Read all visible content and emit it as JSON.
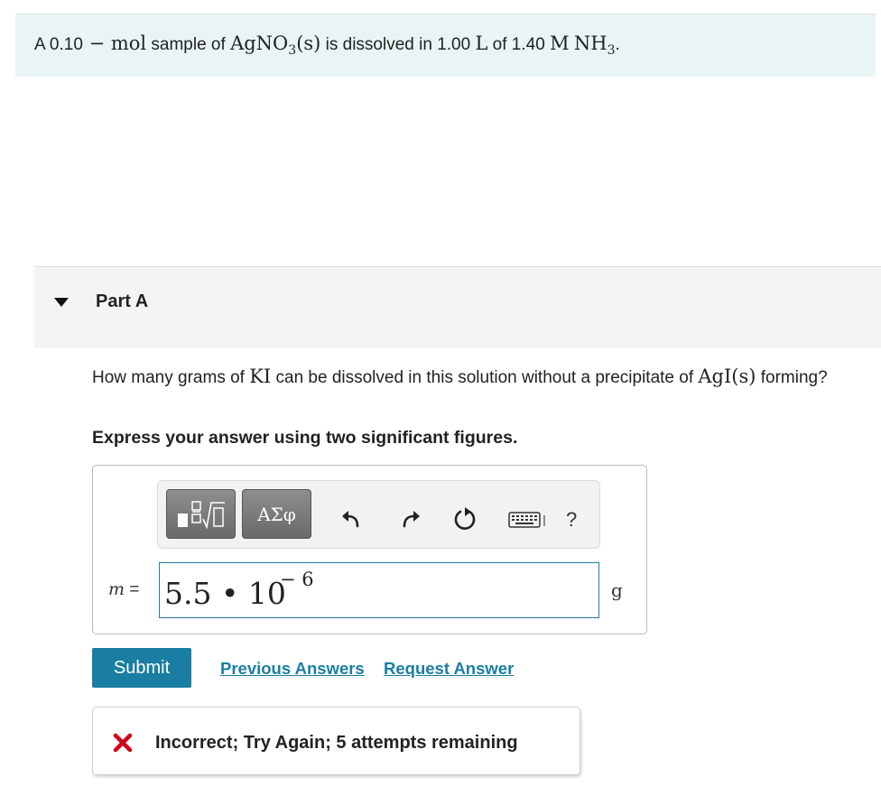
{
  "intro": {
    "prefix": "A 0.10",
    "dash": " − ",
    "mol": "mol",
    "sample_of": " sample of ",
    "compound_main": "AgNO",
    "compound_sub": "3",
    "compound_state": "(s)",
    "dissolved_in": " is dissolved in 1.00 ",
    "liter": "L",
    "of": " of 1.40 ",
    "molar": "M",
    "nh": "NH",
    "nh_sub": "3",
    "period": "."
  },
  "part": {
    "title": "Part A"
  },
  "question": {
    "before": "How many grams of ",
    "ki": "KI",
    "middle": " can be dissolved in this solution without a precipitate of ",
    "agi": "AgI(s)",
    "after": " forming?"
  },
  "instruction": "Express your answer using two significant figures.",
  "toolbar": {
    "templates_icon": "templates-icon",
    "symbols_label": "ΑΣφ",
    "undo_icon": "undo-icon",
    "redo_icon": "redo-icon",
    "reset_icon": "reset-icon",
    "keyboard_icon": "keyboard-icon",
    "help_label": "?"
  },
  "answer": {
    "variable": "m",
    "equals": " =",
    "value": "5.5 • 10",
    "exponent": "− 6",
    "unit": "g"
  },
  "actions": {
    "submit_label": "Submit",
    "previous_answers_label": "Previous Answers",
    "request_answer_label": "Request Answer"
  },
  "feedback": {
    "icon": "x-icon",
    "text": "Incorrect; Try Again; 5 attempts remaining",
    "icon_color": "#d0021b"
  },
  "colors": {
    "intro_bg": "#e8f5f4",
    "accent": "#1a7ea3",
    "part_bg": "#f4f4f4"
  }
}
